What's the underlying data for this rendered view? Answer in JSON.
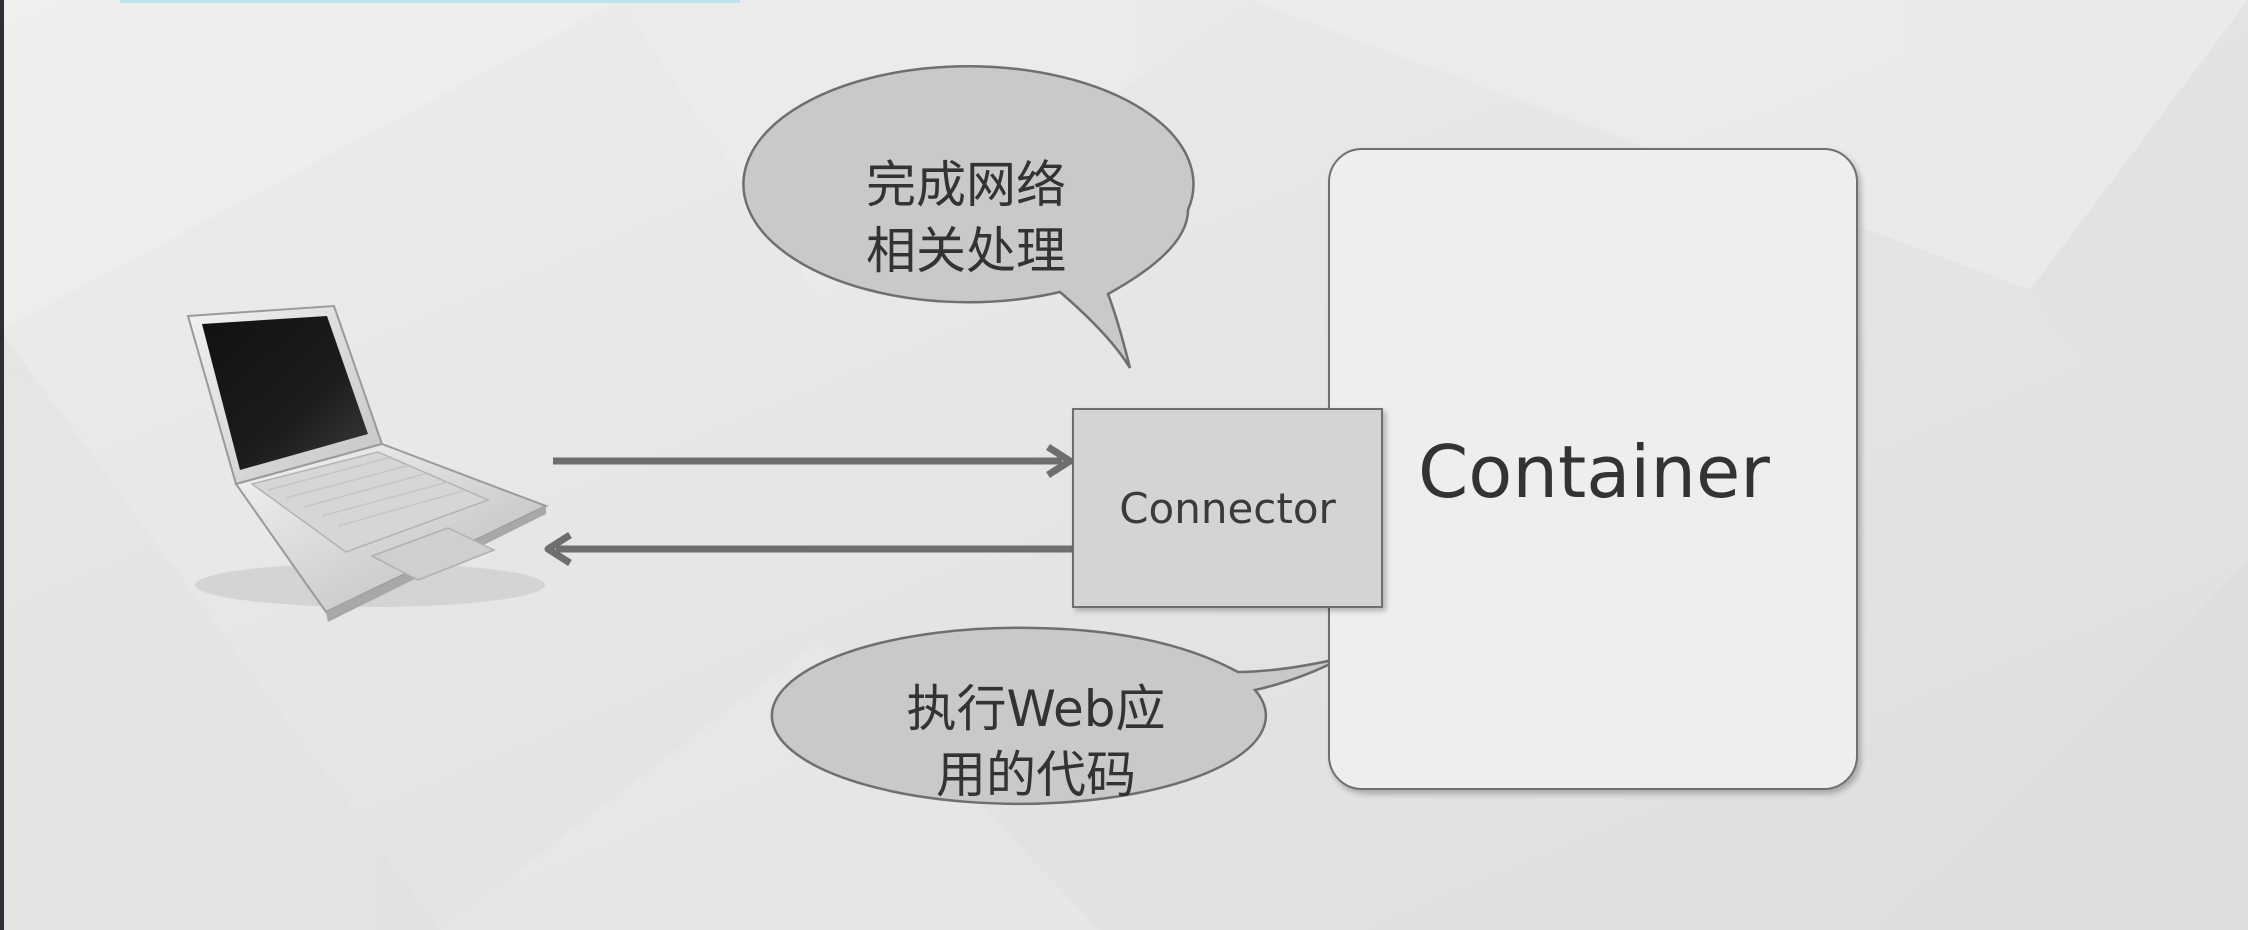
{
  "diagram": {
    "container_label": "Container",
    "connector_label": "Connector",
    "bubble_top": {
      "line1": "完成网络",
      "line2": "相关处理"
    },
    "bubble_bottom": {
      "line1": "执行Web应",
      "line2": "用的代码"
    }
  },
  "icons": {
    "client": "laptop-icon"
  },
  "colors": {
    "background": "#e6e6e6",
    "container_fill": "#eeeeee",
    "connector_fill": "#d4d4d4",
    "bubble_fill": "#c9c9c9",
    "stroke": "#6f6f6f",
    "arrow": "#6e6e6e",
    "text": "#333333"
  }
}
